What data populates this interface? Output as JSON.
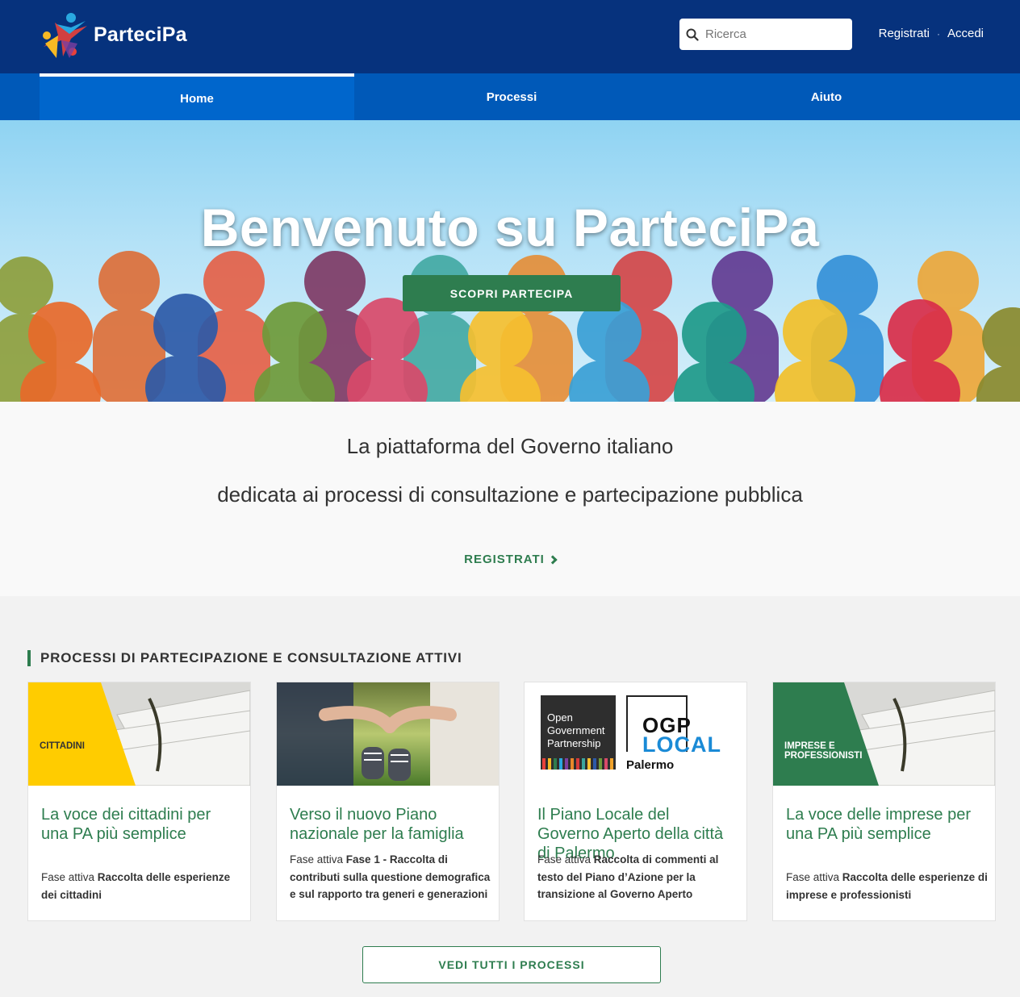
{
  "header": {
    "brand": "ParteciPa",
    "search_placeholder": "Ricerca",
    "register": "Registrati",
    "separator": "·",
    "login": "Accedi",
    "colors": {
      "bar": "#06327d",
      "nav": "#0059b8",
      "accent": "#2e7d4f"
    }
  },
  "nav": {
    "tabs": [
      {
        "label": "Home",
        "active": true
      },
      {
        "label": "Processi",
        "active": false
      },
      {
        "label": "Aiuto",
        "active": false
      }
    ]
  },
  "hero": {
    "title": "Benvenuto su ParteciPa",
    "button": "SCOPRI PARTECIPA"
  },
  "intro": {
    "line1": "La piattaforma del Governo italiano",
    "line2": "dedicata ai processi di consultazione e partecipazione pubblica",
    "link": "REGISTRATI"
  },
  "section": {
    "title": "PROCESSI DI PARTECIPAZIONE E CONSULTAZIONE ATTIVI",
    "cards": [
      {
        "tag": "CITTADINI",
        "title": "La voce dei cittadini per una PA più semplice",
        "phase_label": "Fase attiva",
        "phase": "Raccolta delle esperienze dei cittadini"
      },
      {
        "tag": "",
        "title": "Verso il nuovo Piano nazionale per la famiglia",
        "phase_label": "Fase attiva",
        "phase": "Fase 1 - Raccolta di contributi sulla questione demografica e sul rapporto tra generi e generazioni"
      },
      {
        "tag": "",
        "title": "Il Piano Locale del Governo Aperto della città di Palermo",
        "phase_label": "Fase attiva",
        "phase": "Raccolta di commenti al testo del Piano d’Azione per la transizione al Governo Aperto",
        "logo": {
          "left_line1": "Open",
          "left_line2": "Government",
          "left_line3": "Partnership",
          "right_line1": "OGP",
          "right_line2": "LOCAL",
          "right_line3": "Palermo"
        }
      },
      {
        "tag_line1": "IMPRESE E",
        "tag_line2": "PROFESSIONISTI",
        "title": "La voce delle imprese per una PA più semplice",
        "phase_label": "Fase attiva",
        "phase": "Raccolta delle esperienze di imprese e professionisti"
      }
    ],
    "all_button": "VEDI TUTTI I PROCESSI"
  }
}
